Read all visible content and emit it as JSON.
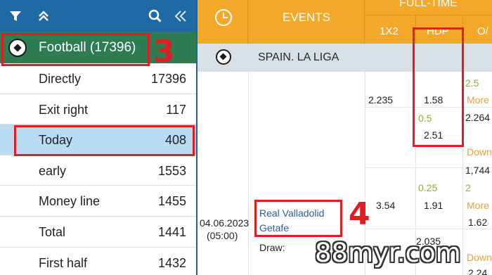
{
  "sidebar": {
    "icons": [
      "filter-icon",
      "chevrons-up-icon",
      "search-icon",
      "chevrons-left-icon"
    ],
    "sport_title": "Football (17396)",
    "items": [
      {
        "label": "Directly",
        "count": "17396"
      },
      {
        "label": "Exit right",
        "count": "117"
      },
      {
        "label": "Today",
        "count": "408",
        "selected": true
      },
      {
        "label": "early",
        "count": "1553"
      },
      {
        "label": "Money line",
        "count": "1455"
      },
      {
        "label": "Total",
        "count": "1441"
      },
      {
        "label": "First half",
        "count": "1432"
      }
    ]
  },
  "grid": {
    "header": {
      "events": "EVENTS",
      "full_time": "FULL-TIME",
      "col_1x2": "1X2",
      "col_hdp": "HDP",
      "col_ou": "O/"
    },
    "league": "SPAIN. LA LIGA",
    "match": {
      "date": "04.06.2023",
      "time": "(05:00)",
      "home": "Real Valladolid",
      "away": "Getafe",
      "draw_label": "Draw:"
    },
    "odds": {
      "row1_1x2": "2.235",
      "row1_hdp": "1.58",
      "row1_ou_line": "2.5",
      "row1_ou_more": "More",
      "row1_ou_val": "2.264",
      "row2_hdp_line": "0.5",
      "row2_hdp": "2.51",
      "row2_ou_down": "Down",
      "row2_ou_val": "1,744",
      "row3_hdp_line": "0.25",
      "row3_ou_line": "2",
      "row3_1x2": "3.54",
      "row3_hdp": "1.91",
      "row3_ou_more": "More",
      "row3_ou_val": "1.62",
      "row4_hdp": "2.035",
      "row4_ou_down": "Down",
      "row4_ou_val": "2.24"
    }
  },
  "annotations": {
    "marker_3": "3",
    "marker_4": "4",
    "watermark": "88myr.com",
    "highlight_color": "#e31b23"
  }
}
